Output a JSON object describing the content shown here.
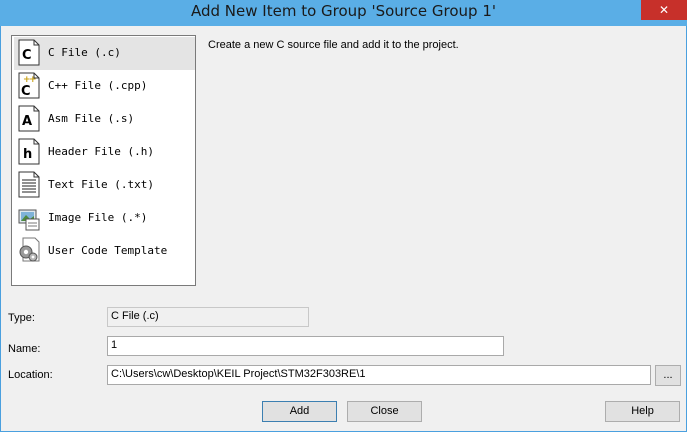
{
  "window": {
    "title": "Add New Item to Group 'Source Group 1'",
    "close_glyph": "✕"
  },
  "file_types": [
    {
      "label": "C File (.c)",
      "icon": "c-file-icon",
      "selected": true
    },
    {
      "label": "C++ File (.cpp)",
      "icon": "cpp-file-icon",
      "selected": false
    },
    {
      "label": "Asm File (.s)",
      "icon": "asm-file-icon",
      "selected": false
    },
    {
      "label": "Header File (.h)",
      "icon": "header-file-icon",
      "selected": false
    },
    {
      "label": "Text File (.txt)",
      "icon": "text-file-icon",
      "selected": false
    },
    {
      "label": "Image File (.*)",
      "icon": "image-file-icon",
      "selected": false
    },
    {
      "label": "User Code Template",
      "icon": "gear-icon",
      "selected": false
    }
  ],
  "description": "Create a new C source file and add it to the project.",
  "form": {
    "type_label": "Type:",
    "type_value": "C File (.c)",
    "name_label": "Name:",
    "name_value": "1",
    "location_label": "Location:",
    "location_value": "C:\\Users\\cw\\Desktop\\KEIL Project\\STM32F303RE\\1",
    "browse_label": "..."
  },
  "buttons": {
    "add": "Add",
    "close": "Close",
    "help": "Help"
  },
  "colors": {
    "title_bar": "#5aaee6",
    "close_button": "#c7302a",
    "selected_row": "#e4e4e4"
  }
}
